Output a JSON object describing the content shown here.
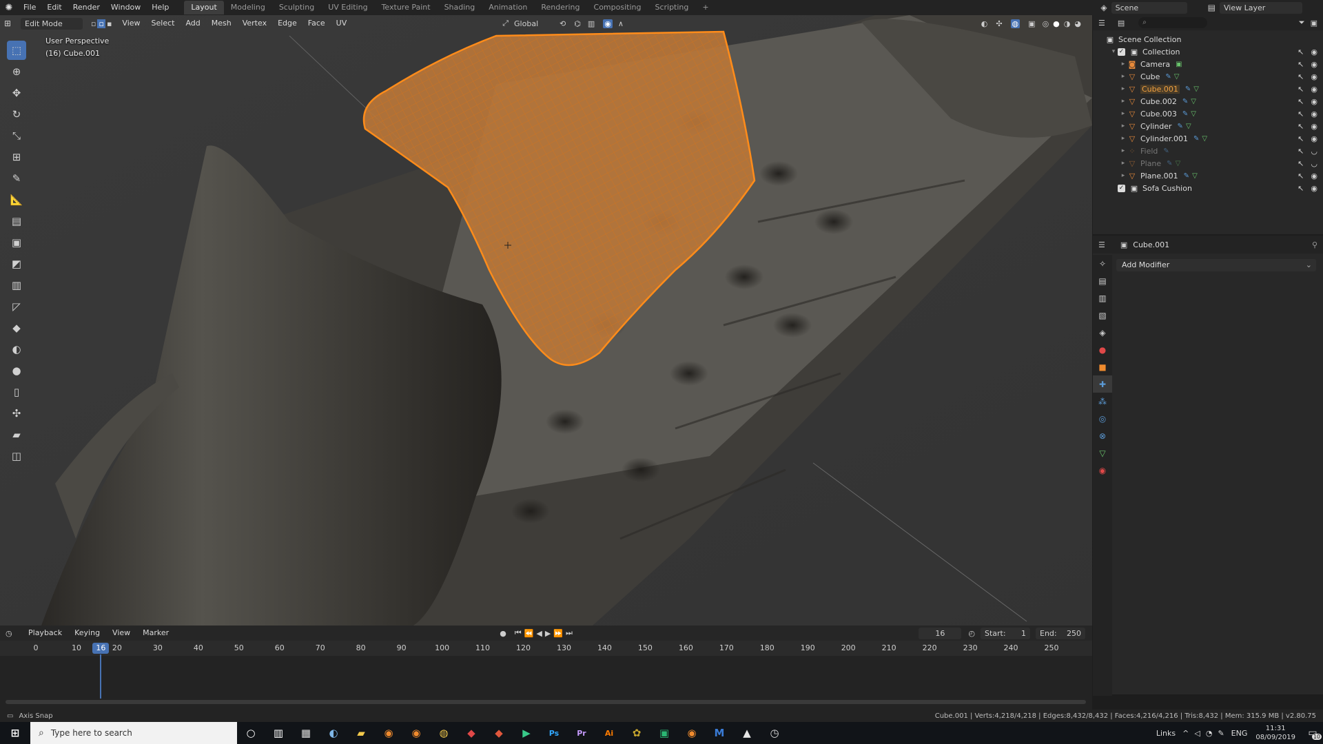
{
  "topbar": {
    "menus": [
      "File",
      "Edit",
      "Render",
      "Window",
      "Help"
    ],
    "workspaces": [
      "Layout",
      "Modeling",
      "Sculpting",
      "UV Editing",
      "Texture Paint",
      "Shading",
      "Animation",
      "Rendering",
      "Compositing",
      "Scripting"
    ],
    "active_workspace": "Layout",
    "add_tab": "+",
    "scene_label": "Scene",
    "view_layer_label": "View Layer"
  },
  "viewport_header": {
    "mode": "Edit Mode",
    "menus": [
      "View",
      "Select",
      "Add",
      "Mesh",
      "Vertex",
      "Edge",
      "Face",
      "UV"
    ],
    "orientation": "Global"
  },
  "viewport": {
    "perspective_label": "User Perspective",
    "object_label": "(16) Cube.001"
  },
  "outliner": {
    "root": "Scene Collection",
    "collection": "Collection",
    "items": [
      {
        "name": "Camera",
        "state": "normal",
        "kind": "camera"
      },
      {
        "name": "Cube",
        "state": "normal",
        "kind": "mesh"
      },
      {
        "name": "Cube.001",
        "state": "selected",
        "kind": "mesh"
      },
      {
        "name": "Cube.002",
        "state": "normal",
        "kind": "mesh"
      },
      {
        "name": "Cube.003",
        "state": "normal",
        "kind": "mesh"
      },
      {
        "name": "Cylinder",
        "state": "normal",
        "kind": "mesh"
      },
      {
        "name": "Cylinder.001",
        "state": "normal",
        "kind": "mesh"
      },
      {
        "name": "Field",
        "state": "hidden",
        "kind": "field"
      },
      {
        "name": "Plane",
        "state": "hidden",
        "kind": "mesh"
      },
      {
        "name": "Plane.001",
        "state": "normal",
        "kind": "mesh"
      }
    ],
    "extra_collection": "Sofa Cushion"
  },
  "properties": {
    "object_name": "Cube.001",
    "add_modifier": "Add Modifier"
  },
  "timeline": {
    "menus": [
      "Playback",
      "Keying",
      "View",
      "Marker"
    ],
    "current_frame": "16",
    "start_label": "Start:",
    "start_value": "1",
    "end_label": "End:",
    "end_value": "250",
    "ruler": [
      "0",
      "10",
      "20",
      "30",
      "40",
      "50",
      "60",
      "70",
      "80",
      "90",
      "100",
      "110",
      "120",
      "130",
      "140",
      "150",
      "160",
      "170",
      "180",
      "190",
      "200",
      "210",
      "220",
      "230",
      "240",
      "250"
    ]
  },
  "statusbar": {
    "left": "Axis Snap",
    "right": "Cube.001 | Verts:4,218/4,218 | Edges:8,432/8,432 | Faces:4,216/4,216 | Tris:8,432 | Mem: 315.9 MB | v2.80.75"
  },
  "taskbar": {
    "search_placeholder": "Type here to search",
    "apps": [
      {
        "icon": "calculator-icon",
        "glyph": "▦",
        "color": "#dddddd"
      },
      {
        "icon": "edge-icon",
        "glyph": "◐",
        "color": "#7fb7e8"
      },
      {
        "icon": "file-explorer-icon",
        "glyph": "▰",
        "color": "#f2c94c"
      },
      {
        "icon": "blender-icon",
        "glyph": "◉",
        "color": "#f08b2e"
      },
      {
        "icon": "blender-icon",
        "glyph": "◉",
        "color": "#f08b2e"
      },
      {
        "icon": "chrome-icon",
        "glyph": "◍",
        "color": "#e9c24a"
      },
      {
        "icon": "app-red-icon",
        "glyph": "◆",
        "color": "#e04848"
      },
      {
        "icon": "app-red-icon",
        "glyph": "◆",
        "color": "#e0573c"
      },
      {
        "icon": "play-icon",
        "glyph": "▶",
        "color": "#38c989"
      },
      {
        "icon": "photoshop-icon",
        "glyph": "Ps",
        "color": "#31a8ff"
      },
      {
        "icon": "premiere-icon",
        "glyph": "Pr",
        "color": "#c79cff"
      },
      {
        "icon": "illustrator-icon",
        "glyph": "Ai",
        "color": "#ff7c00"
      },
      {
        "icon": "color-app-icon",
        "glyph": "✿",
        "color": "#c6a52e"
      },
      {
        "icon": "green-app-icon",
        "glyph": "▣",
        "color": "#2bb673"
      },
      {
        "icon": "blender-icon",
        "glyph": "◉",
        "color": "#f08b2e"
      },
      {
        "icon": "app-m-icon",
        "glyph": "M",
        "color": "#3a7bd5"
      },
      {
        "icon": "photos-icon",
        "glyph": "▲",
        "color": "#e6e6e6"
      },
      {
        "icon": "clock-app-icon",
        "glyph": "◷",
        "color": "#dddddd"
      }
    ],
    "links_label": "Links",
    "lang": "ENG",
    "time": "11:31",
    "date": "08/09/2019",
    "notif_count": "10"
  },
  "colors": {
    "accent": "#4772b3",
    "selected": "#f0a040",
    "wire": "#e88a2a"
  }
}
